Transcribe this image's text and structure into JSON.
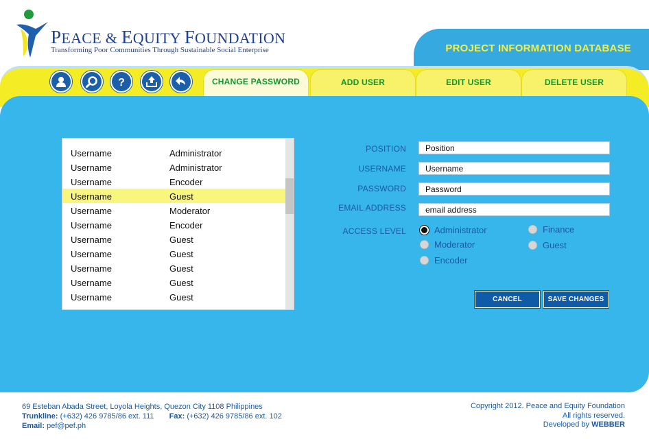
{
  "header": {
    "org_name_P": "P",
    "org_name_rest1": "EACE & ",
    "org_name_E": "E",
    "org_name_rest2": "QUITY ",
    "org_name_F": "F",
    "org_name_rest3": "OUNDATION",
    "tagline": "Transforming Poor Communities Through Sustainable Social Enterprise",
    "database_title": "PROJECT INFORMATION DATABASE"
  },
  "toolbar": {
    "icons": [
      "user-icon",
      "search-icon",
      "help-icon",
      "upload-icon",
      "back-icon"
    ],
    "tabs": [
      "CHANGE PASSWORD",
      "ADD USER",
      "EDIT USER",
      "DELETE USER"
    ],
    "active_tab": "CHANGE PASSWORD"
  },
  "user_list": {
    "rows": [
      {
        "username": "Username",
        "level": "Administrator"
      },
      {
        "username": "Username",
        "level": "Administrator"
      },
      {
        "username": "Username",
        "level": "Encoder"
      },
      {
        "username": "Username",
        "level": "Guest"
      },
      {
        "username": "Username",
        "level": "Moderator"
      },
      {
        "username": "Username",
        "level": "Encoder"
      },
      {
        "username": "Username",
        "level": "Guest"
      },
      {
        "username": "Username",
        "level": "Guest"
      },
      {
        "username": "Username",
        "level": "Guest"
      },
      {
        "username": "Username",
        "level": "Guest"
      },
      {
        "username": "Username",
        "level": "Guest"
      }
    ],
    "selected_index": 3
  },
  "form": {
    "position_label": "POSITION",
    "position_value": "Position",
    "username_label": "USERNAME",
    "username_value": "Username",
    "password_label": "PASSWORD",
    "password_value": "Password",
    "email_label": "EMAIL ADDRESS",
    "email_value": "email address",
    "access_label": "ACCESS LEVEL",
    "access_options": [
      "Administrator",
      "Finance",
      "Moderator",
      "Guest",
      "Encoder"
    ],
    "access_selected": "Administrator",
    "cancel_label": "CANCEL",
    "save_label": "SAVE CHANGES"
  },
  "footer": {
    "address": "69 Esteban Abada Street, Loyola Heights, Quezon City 1108 Philippines",
    "trunkline_label": "Trunkline:",
    "trunkline_value": "(+632) 426 9785/86 ext. 111",
    "fax_label": "Fax:",
    "fax_value": "(+632) 426 9785/86 ext. 102",
    "email_label": "Email:",
    "email_value": "pef@pef.ph",
    "copyright": "Copyright 2012. Peace and Equity Foundation",
    "rights": "All rights reserved.",
    "developed_by": "Developed by ",
    "developer": "WEBBER"
  },
  "colors": {
    "brand_blue": "#1f3f8f",
    "panel_blue": "#36b6eb",
    "toolbar_yellow": "#f4ec25",
    "tab_text_green": "#10962f",
    "button_blue": "#0f5ba8",
    "selected_row": "#f8f67c"
  }
}
